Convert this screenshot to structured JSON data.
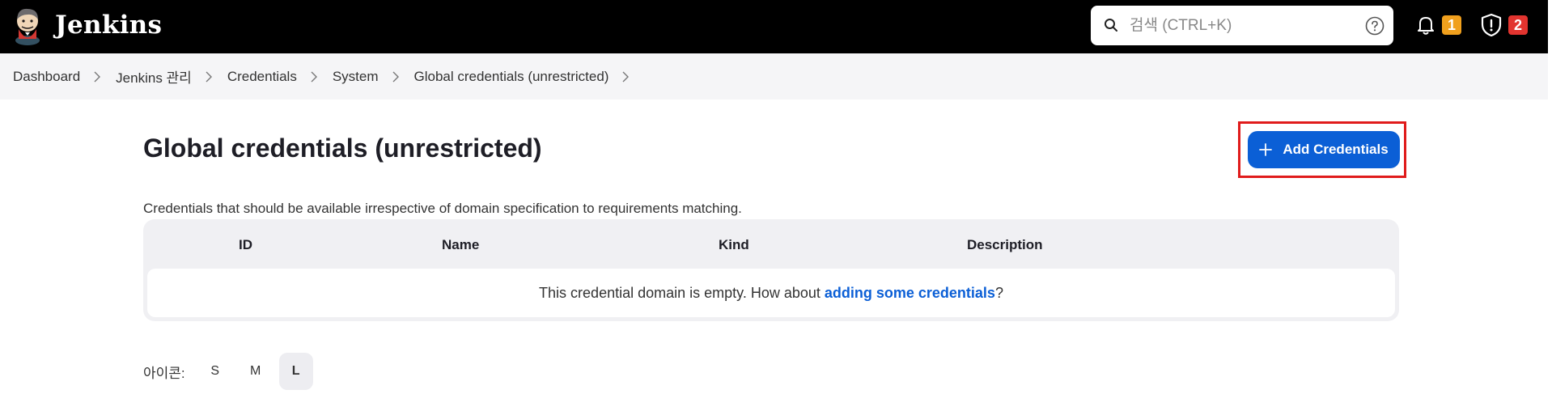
{
  "header": {
    "brand": "Jenkins",
    "search": {
      "placeholder": "검색 (CTRL+K)",
      "value": ""
    },
    "notifications": {
      "count": "1",
      "color": "#f0a01d"
    },
    "security": {
      "count": "2",
      "color": "#e2342f"
    }
  },
  "breadcrumb": {
    "items": [
      "Dashboard",
      "Jenkins 관리",
      "Credentials",
      "System",
      "Global credentials (unrestricted)"
    ]
  },
  "page": {
    "title": "Global credentials (unrestricted)",
    "add_button_label": "Add Credentials",
    "description": "Credentials that should be available irrespective of domain specification to requirements matching."
  },
  "table": {
    "columns": [
      "ID",
      "Name",
      "Kind",
      "Description"
    ],
    "empty_text_before": "This credential domain is empty. How about ",
    "empty_link": "adding some credentials",
    "empty_text_after": "?"
  },
  "icon_size": {
    "label": "아이콘:",
    "options": [
      "S",
      "M",
      "L"
    ],
    "selected": "L"
  },
  "colors": {
    "accent": "#0b5fd6",
    "highlight": "#e01b1b",
    "header_bg": "#000000"
  }
}
